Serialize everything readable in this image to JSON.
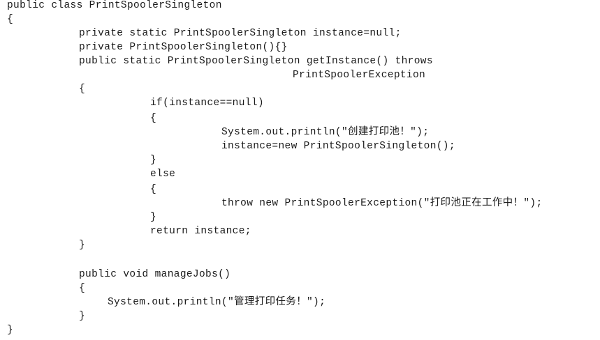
{
  "code": {
    "lines": [
      "public class PrintSpoolerSingleton",
      "{",
      "private static PrintSpoolerSingleton instance=null;",
      "private PrintSpoolerSingleton(){}",
      "public static PrintSpoolerSingleton getInstance() throws",
      "PrintSpoolerException",
      "{",
      "if(instance==null)",
      "{",
      "System.out.println(\"创建打印池！\");",
      "instance=new PrintSpoolerSingleton();",
      "}",
      "else",
      "{",
      "throw new PrintSpoolerException(\"打印池正在工作中！\");",
      "}",
      "return instance;",
      "}",
      "public void manageJobs()",
      "{",
      "System.out.println(\"管理打印任务！\");",
      "}",
      "}"
    ]
  }
}
